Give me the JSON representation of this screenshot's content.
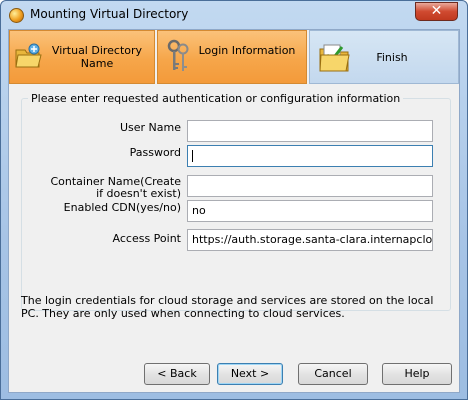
{
  "window": {
    "title": "Mounting Virtual Directory",
    "close_glyph": "✕"
  },
  "steps": [
    {
      "label": "Virtual Directory Name",
      "icon": "folder-icon",
      "state": "completed"
    },
    {
      "label": "Login Information",
      "icon": "keys-icon",
      "state": "current"
    },
    {
      "label": "Finish",
      "icon": "finish-icon",
      "state": "pending"
    }
  ],
  "form": {
    "heading": "Please enter requested authentication or configuration information",
    "fields": {
      "user_name": {
        "label": "User Name",
        "value": ""
      },
      "password": {
        "label": "Password",
        "value": ""
      },
      "container_name": {
        "label": "Container Name(Create if doesn't exist)",
        "value": ""
      },
      "enabled_cdn": {
        "label": "Enabled CDN(yes/no)",
        "value": "no"
      },
      "access_point": {
        "label": "Access Point",
        "value": "https://auth.storage.santa-clara.internapcloud.net"
      }
    }
  },
  "info_text": "The login credentials for cloud storage and services are stored on the local PC. They are only used when connecting to cloud services.",
  "buttons": {
    "back": "< Back",
    "next": "Next >",
    "cancel": "Cancel",
    "help": "Help"
  },
  "colors": {
    "step_active": "#f6a64a",
    "step_pending": "#c3d8ee",
    "title_bar": "#b3cde9",
    "close_button": "#d04a30"
  }
}
